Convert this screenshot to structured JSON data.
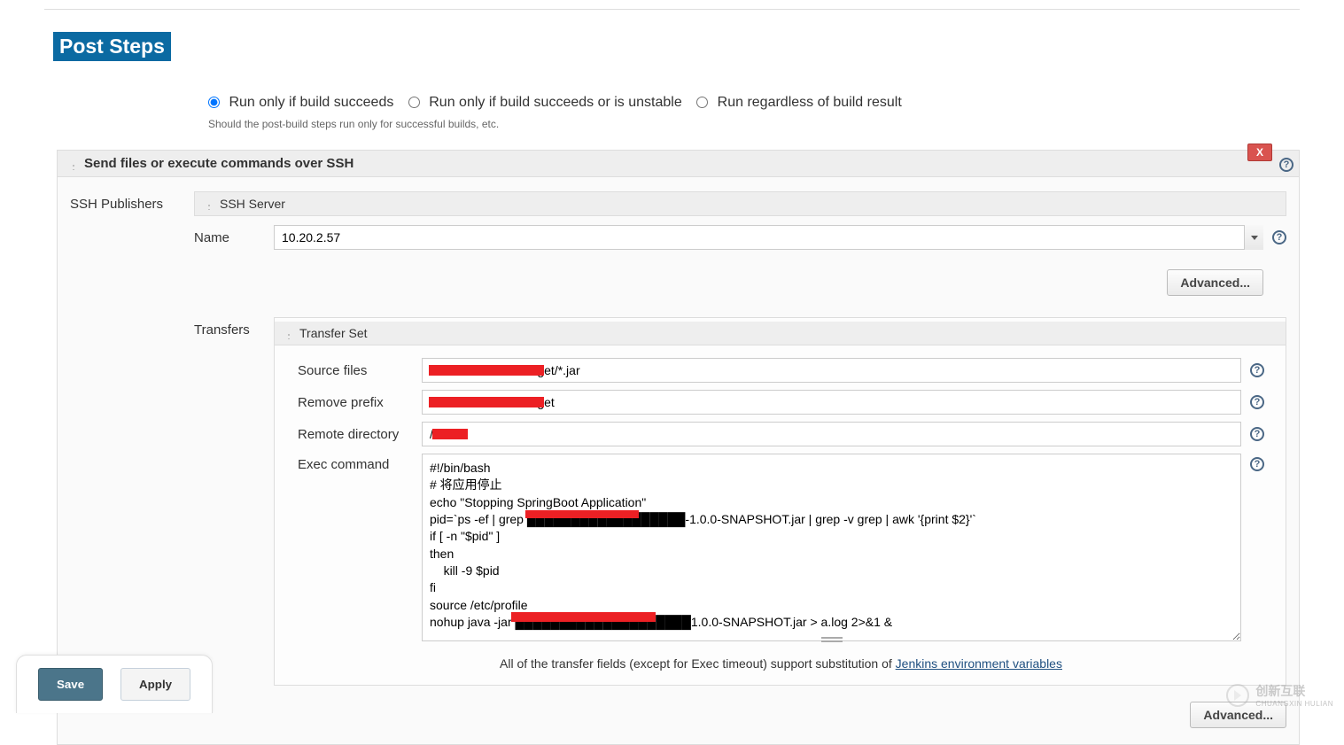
{
  "section": {
    "title": "Post Steps"
  },
  "radios": {
    "option1": "Run only if build succeeds",
    "option2": "Run only if build succeeds or is unstable",
    "option3": "Run regardless of build result",
    "help": "Should the post-build steps run only for successful builds, etc."
  },
  "step": {
    "title": "Send files or execute commands over SSH",
    "remove_label": "X",
    "publishers_label": "SSH Publishers",
    "ssh_server": {
      "header": "SSH Server",
      "name_label": "Name",
      "name_value": "10.20.2.57",
      "advanced": "Advanced..."
    },
    "transfers": {
      "label": "Transfers",
      "set_header": "Transfer Set",
      "source_files_label": "Source files",
      "source_files_value": "                          /target/*.jar",
      "remove_prefix_label": "Remove prefix",
      "remove_prefix_value": "                          /target",
      "remote_dir_label": "Remote directory",
      "remote_dir_value": "/",
      "exec_label": "Exec command",
      "exec_value": "#!/bin/bash\n# 将应用停止\necho \"Stopping SpringBoot Application\"\npid=`ps -ef | grep ██████████████████-1.0.0-SNAPSHOT.jar | grep -v grep | awk '{print $2}'`\nif [ -n \"$pid\" ]\nthen\n    kill -9 $pid\nfi\nsource /etc/profile\nnohup java -jar ████████████████████1.0.0-SNAPSHOT.jar > a.log 2>&1 &",
      "help_text_prefix": "All of the transfer fields (except for Exec timeout) support substitution of ",
      "help_link": "Jenkins environment variables",
      "advanced": "Advanced..."
    }
  },
  "footer": {
    "save": "Save",
    "apply": "Apply"
  },
  "watermark": {
    "cn": "创新互联",
    "py": "CHUANGXIN HULIAN"
  }
}
